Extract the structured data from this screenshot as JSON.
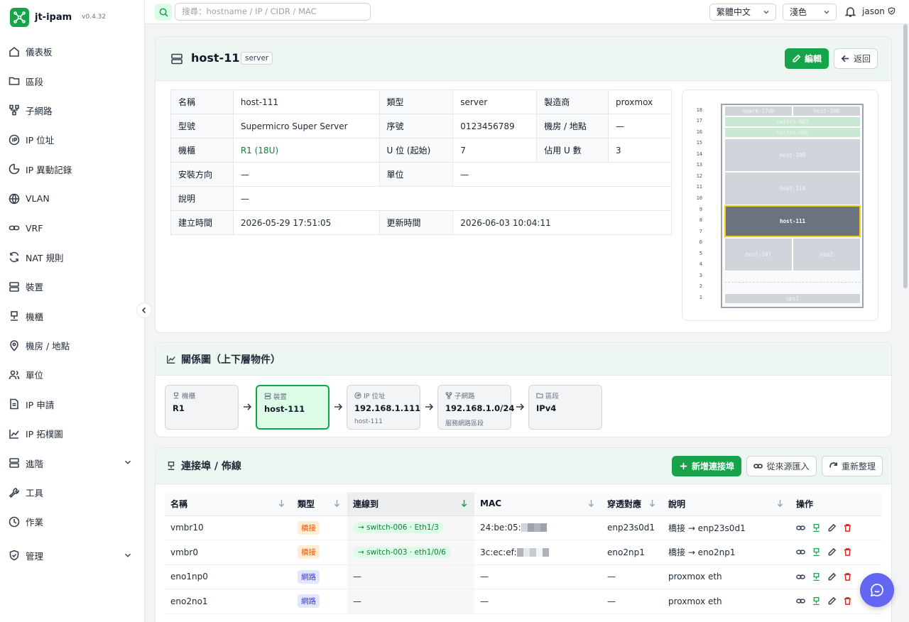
{
  "app": {
    "name": "jt-ipam",
    "version": "v0.4.32"
  },
  "sidebar": {
    "items": [
      {
        "label": "儀表板",
        "icon": "home-icon"
      },
      {
        "label": "區段",
        "icon": "folder-icon"
      },
      {
        "label": "子網路",
        "icon": "subnet-icon"
      },
      {
        "label": "IP 位址",
        "icon": "ip-icon"
      },
      {
        "label": "IP 異動記錄",
        "icon": "history-icon"
      },
      {
        "label": "VLAN",
        "icon": "globe-icon"
      },
      {
        "label": "VRF",
        "icon": "link-icon"
      },
      {
        "label": "NAT 規則",
        "icon": "refresh-icon"
      },
      {
        "label": "裝置",
        "icon": "server-icon"
      },
      {
        "label": "機櫃",
        "icon": "rack-icon"
      },
      {
        "label": "機房 / 地點",
        "icon": "location-icon"
      },
      {
        "label": "單位",
        "icon": "users-icon"
      },
      {
        "label": "IP 申請",
        "icon": "document-icon"
      },
      {
        "label": "IP 拓樸圖",
        "icon": "chart-icon"
      },
      {
        "label": "進階",
        "icon": "server-icon"
      },
      {
        "label": "工具",
        "icon": "wrench-icon"
      },
      {
        "label": "作業",
        "icon": "clock-icon"
      },
      {
        "label": "管理",
        "icon": "shield-icon"
      }
    ]
  },
  "topbar": {
    "search_placeholder": "搜尋：hostname / IP / CIDR / MAC",
    "language": "繁體中文",
    "theme": "淺色",
    "user": "jason"
  },
  "device": {
    "name": "host-111",
    "type_tag": "server",
    "edit_label": "編輯",
    "back_label": "返回",
    "fields": [
      [
        {
          "k": "名稱",
          "v": "host-111"
        },
        {
          "k": "類型",
          "v": "server"
        },
        {
          "k": "製造商",
          "v": "proxmox"
        }
      ],
      [
        {
          "k": "型號",
          "v": "Supermicro Super Server"
        },
        {
          "k": "序號",
          "v": "0123456789"
        },
        {
          "k": "機房 / 地點",
          "v": "—"
        }
      ],
      [
        {
          "k": "機櫃",
          "v": "R1 (18U)"
        },
        {
          "k": "U 位 (起始)",
          "v": "7"
        },
        {
          "k": "佔用 U 數",
          "v": "3"
        }
      ],
      [
        {
          "k": "安裝方向",
          "v": "—"
        },
        {
          "k": "單位",
          "v": "—"
        }
      ],
      [
        {
          "k": "說明",
          "v": "—"
        }
      ],
      [
        {
          "k": "建立時間",
          "v": "2026-05-29 17:51:05"
        },
        {
          "k": "更新時間",
          "v": "2026-06-03 10:04:11"
        }
      ]
    ]
  },
  "rack": {
    "units": [
      "18",
      "17",
      "16",
      "15",
      "14",
      "13",
      "12",
      "11",
      "10",
      "9",
      "8",
      "7",
      "6",
      "5",
      "4",
      "3",
      "2",
      "1"
    ],
    "devices": [
      {
        "label": "spark-17db"
      },
      {
        "label": "host-108"
      },
      {
        "label": "switch-003"
      },
      {
        "label": "switch-006"
      },
      {
        "label": "host-109"
      },
      {
        "label": "host-110"
      },
      {
        "label": "host-111"
      },
      {
        "label": "host-107"
      },
      {
        "label": "nas2"
      },
      {
        "label": "ups1"
      }
    ]
  },
  "relation": {
    "title": "關係圖（上下層物件）",
    "nodes": [
      {
        "type": "機櫃",
        "value": "R1",
        "sub": ""
      },
      {
        "type": "裝置",
        "value": "host-111",
        "sub": ""
      },
      {
        "type": "IP 位址",
        "value": "192.168.1.111",
        "sub": "host-111"
      },
      {
        "type": "子網路",
        "value": "192.168.1.0/24",
        "sub": "服務網路區段"
      },
      {
        "type": "區段",
        "value": "IPv4",
        "sub": ""
      }
    ]
  },
  "ports": {
    "title": "連接埠 / 佈線",
    "add_label": "新增連接埠",
    "import_label": "從來源匯入",
    "refresh_label": "重新整理",
    "columns": [
      "名稱",
      "類型",
      "連線到",
      "MAC",
      "穿透對應",
      "說明",
      "操作"
    ],
    "rows": [
      {
        "name": "vmbr10",
        "type": "橋接",
        "conn": "→ switch-006 · Eth1/3",
        "mac": "24:be:05:",
        "passthru": "enp23s0d1",
        "desc": "橋接 → enp23s0d1"
      },
      {
        "name": "vmbr0",
        "type": "橋接",
        "conn": "→ switch-003 · eth1/0/6",
        "mac": "3c:ec:ef:",
        "passthru": "eno2np1",
        "desc": "橋接 → eno2np1"
      },
      {
        "name": "eno1np0",
        "type": "網路",
        "conn": "—",
        "mac": "—",
        "passthru": "—",
        "desc": "proxmox eth"
      },
      {
        "name": "eno2no1",
        "type": "網路",
        "conn": "—",
        "mac": "—",
        "passthru": "—",
        "desc": "proxmox eth"
      }
    ]
  }
}
